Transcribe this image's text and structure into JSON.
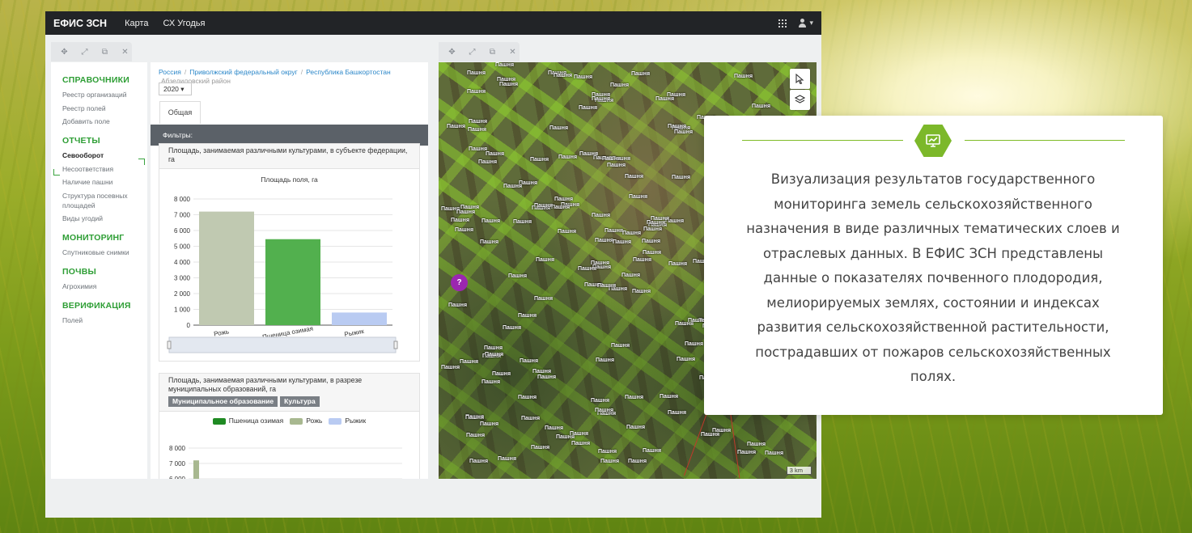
{
  "app": {
    "brand": "ЕФИС ЗСН",
    "nav": [
      "Карта",
      "СХ Угодья"
    ]
  },
  "sidebar": {
    "sections": [
      {
        "title": "СПРАВОЧНИКИ",
        "items": [
          "Реестр организаций",
          "Реестр полей",
          "Добавить поле"
        ]
      },
      {
        "title": "ОТЧЕТЫ",
        "items": [
          "Севооборот",
          "Несоответствия",
          "Наличие пашни",
          "Структура посевных площадей",
          "Виды угодий"
        ]
      },
      {
        "title": "МОНИТОРИНГ",
        "items": [
          "Спутниковые снимки"
        ]
      },
      {
        "title": "ПОЧВЫ",
        "items": [
          "Агрохимия"
        ]
      },
      {
        "title": "ВЕРИФИКАЦИЯ",
        "items": [
          "Полей"
        ]
      }
    ],
    "active_item": "Севооборот"
  },
  "content": {
    "breadcrumb": [
      "Россия",
      "Приволжский федеральный округ",
      "Республика Башкортостан"
    ],
    "breadcrumb_sub": "Абзелиловский район",
    "year": "2020",
    "tab": "Общая",
    "filters_label": "Фильтры:",
    "card1": {
      "title": "Площадь, занимаемая различными культурами, в субъекте федерации, га",
      "chart_title": "Площадь поля, га"
    },
    "card2": {
      "title": "Площадь, занимаемая различными культурами, в разрезе муниципальных образований, га",
      "tags": [
        "Муниципальное образование",
        "Культура"
      ]
    }
  },
  "chart_data": [
    {
      "type": "bar",
      "title": "Площадь поля, га",
      "categories": [
        "Рожь",
        "Пшеница озимая",
        "Рыжик"
      ],
      "values": [
        7200,
        5450,
        800
      ],
      "colors": [
        "#c0c9b1",
        "#52b04e",
        "#b9cbf2"
      ],
      "yticks": [
        "8 000",
        "7 000",
        "6 000",
        "5 000",
        "4 000",
        "3 000",
        "2 000",
        "1 000",
        "0"
      ],
      "ylim": [
        0,
        8000
      ]
    },
    {
      "type": "bar",
      "legend": [
        {
          "name": "Пшеница озимая",
          "color": "#1f8a23"
        },
        {
          "name": "Рожь",
          "color": "#a8b890"
        },
        {
          "name": "Рыжик",
          "color": "#b9cbf2"
        }
      ],
      "yticks": [
        "8 000",
        "7 000",
        "6 000"
      ],
      "series": [
        {
          "name": "Рожь",
          "values": [
            7200
          ]
        }
      ],
      "ylim": [
        6000,
        8000
      ]
    }
  ],
  "map": {
    "field_label": "Пашня",
    "scale": "3 km"
  },
  "info": {
    "text": "Визуализация результатов государственного мониторинга земель сельскохозяйственного назначения в виде различных тематических слоев и отраслевых данных. В ЕФИС ЗСН представлены данные о показателях почвенного плодородия, мелиорируемых землях, состоянии и индексах развития сельскохозяйственной растительности, пострадавших от пожаров сельскохозяйственных полях.",
    "accent_color": "#7cb82a"
  }
}
